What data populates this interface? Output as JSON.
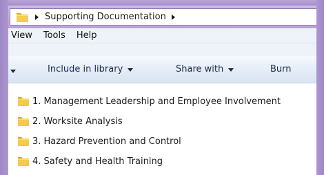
{
  "address_bar": {
    "breadcrumb": "Supporting Documentation"
  },
  "menu": {
    "items": [
      "View",
      "Tools",
      "Help"
    ]
  },
  "toolbar": {
    "include_in_library": "Include in library",
    "share_with": "Share with",
    "burn": "Burn"
  },
  "files": [
    {
      "name": "1. Management Leadership and Employee Involvement",
      "icon": "folder-icon"
    },
    {
      "name": "2. Worksite Analysis",
      "icon": "folder-icon"
    },
    {
      "name": "3. Hazard Prevention and Control",
      "icon": "folder-icon"
    },
    {
      "name": "4. Safety and Health Training",
      "icon": "folder-icon"
    }
  ],
  "colors": {
    "window_frame": "#9d85c4",
    "menubar_bg": "#eef3fa",
    "toolbar_bg": "#e4ecf7",
    "folder_yellow": "#f2c43f"
  }
}
